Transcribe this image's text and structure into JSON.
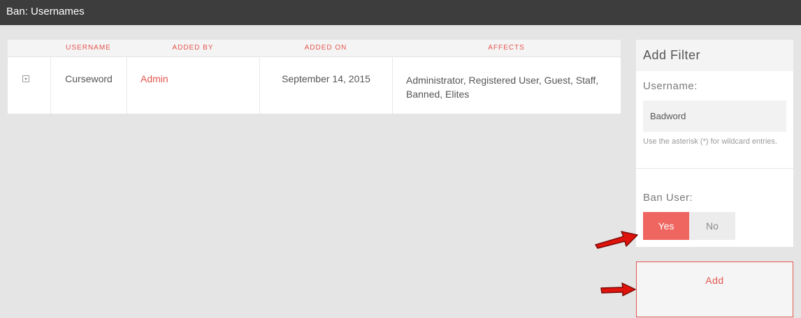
{
  "header": {
    "title": "Ban: Usernames"
  },
  "table": {
    "columns": [
      "",
      "USERNAME",
      "ADDED BY",
      "ADDED ON",
      "AFFECTS"
    ],
    "rows": [
      {
        "username": "Curseword",
        "added_by": "Admin",
        "added_on": "September 14, 2015",
        "affects_line1": "Administrator, Registered User, Guest, Staff,",
        "affects_line2": "Banned, Elites"
      }
    ]
  },
  "add_filter": {
    "title": "Add Filter",
    "username_label": "Username:",
    "username_value": "Badword",
    "username_help": "Use the asterisk (*) for wildcard entries.",
    "ban_user_label": "Ban User:",
    "ban_yes_label": "Yes",
    "ban_no_label": "No",
    "ban_user_selected": "Yes",
    "add_button_label": "Add"
  },
  "colors": {
    "accent": "#e4574f",
    "toggle_active": "#ef6560",
    "header_bg": "#3d3d3d",
    "page_bg": "#e5e5e5",
    "annotation_arrow": "#e0120c"
  },
  "icons": {
    "expand": "chevron-down-icon",
    "annotation": "red-arrow-icon"
  }
}
